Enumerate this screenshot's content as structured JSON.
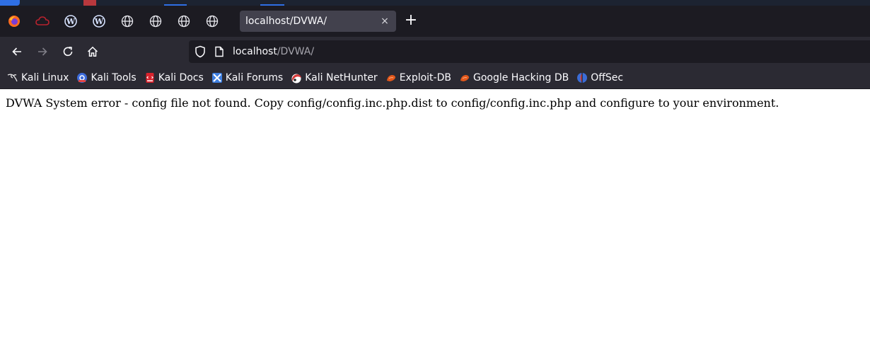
{
  "browser": {
    "active_tab": {
      "title": "localhost/DVWA/",
      "close_glyph": "×"
    },
    "new_tab_glyph": "+",
    "pinned_tabs": [
      {
        "icon": "firefox-icon"
      },
      {
        "icon": "cloud-icon"
      },
      {
        "icon": "wordpress-icon"
      },
      {
        "icon": "wordpress-icon"
      },
      {
        "icon": "globe-icon"
      },
      {
        "icon": "globe-icon"
      },
      {
        "icon": "globe-icon"
      },
      {
        "icon": "globe-icon"
      }
    ],
    "url": {
      "host": "localhost",
      "path": "/DVWA/"
    },
    "bookmarks": [
      {
        "label": "Kali Linux",
        "icon": "kali-dragon-icon",
        "color": "#dddddd"
      },
      {
        "label": "Kali Tools",
        "icon": "kali-tools-icon",
        "color": "#3d6cdb"
      },
      {
        "label": "Kali Docs",
        "icon": "kali-docs-icon",
        "color": "#d9232d"
      },
      {
        "label": "Kali Forums",
        "icon": "kali-forums-icon",
        "color": "#3f7fe0"
      },
      {
        "label": "Kali NetHunter",
        "icon": "nethunter-icon",
        "color": "#d53a3a"
      },
      {
        "label": "Exploit-DB",
        "icon": "exploit-db-icon",
        "color": "#e3581b"
      },
      {
        "label": "Google Hacking DB",
        "icon": "ghdb-icon",
        "color": "#e3581b"
      },
      {
        "label": "OffSec",
        "icon": "offsec-icon",
        "color": "#3b6cd6"
      }
    ]
  },
  "page": {
    "error_message": "DVWA System error - config file not found. Copy config/config.inc.php.dist to config/config.inc.php and configure to your environment."
  },
  "colors": {
    "tabbar_bg": "#1c1b22",
    "toolbar_bg": "#2b2a33",
    "active_tab_bg": "#42414d",
    "page_bg": "#ffffff"
  }
}
